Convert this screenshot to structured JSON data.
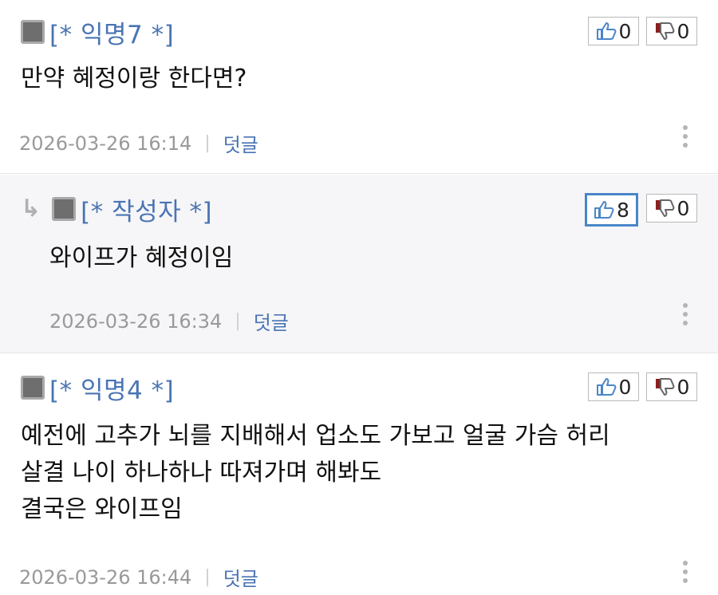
{
  "comments": [
    {
      "author": "[* 익명7 *]",
      "is_reply": false,
      "likes": "0",
      "dislikes": "0",
      "text": "만약 혜정이랑 한다면?",
      "timestamp": "2026-03-26 16:14",
      "reply_label": "덧글"
    },
    {
      "author": "[* 작성자 *]",
      "is_reply": true,
      "likes": "8",
      "dislikes": "0",
      "text": "와이프가 혜정이임",
      "timestamp": "2026-03-26 16:34",
      "reply_label": "덧글"
    },
    {
      "author": "[* 익명4 *]",
      "is_reply": false,
      "likes": "0",
      "dislikes": "0",
      "text": "예전에 고추가 뇌를 지배해서 업소도 가보고 얼굴 가슴 허리\n살결 나이 하나하나 따져가며 해봐도\n결국은 와이프임",
      "timestamp": "2026-03-26 16:44",
      "reply_label": "덧글"
    }
  ],
  "colors": {
    "nickname": "#4a74b3",
    "reply_bg": "#f6f6f8",
    "active_border": "#4a86c8"
  },
  "icons": {
    "like": "thumbs-up-icon",
    "dislike": "thumbs-down-icon",
    "more": "more-vertical-icon",
    "reply_arrow": "reply-arrow-icon",
    "avatar": "avatar-square-icon"
  }
}
